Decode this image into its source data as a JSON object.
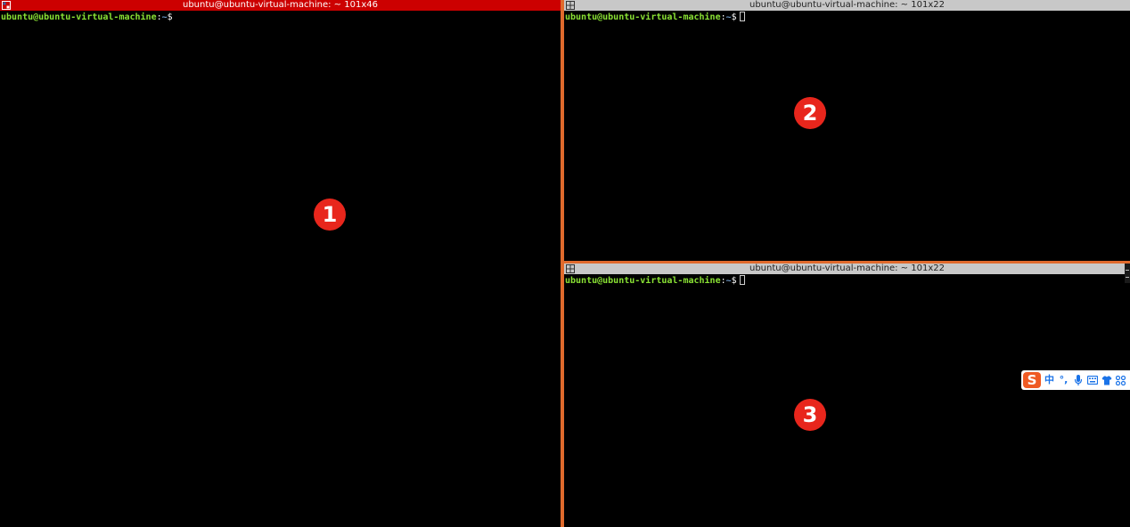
{
  "terminals": [
    {
      "title": "ubuntu@ubuntu-virtual-machine: ~ 101x46",
      "active": true,
      "prompt": {
        "user_host": "ubuntu@ubuntu-virtual-machine",
        "separator": ":",
        "path": "~",
        "symbol": "$"
      },
      "badge": "1"
    },
    {
      "title": "ubuntu@ubuntu-virtual-machine: ~ 101x22",
      "active": false,
      "prompt": {
        "user_host": "ubuntu@ubuntu-virtual-machine",
        "separator": ":",
        "path": "~",
        "symbol": "$"
      },
      "badge": "2"
    },
    {
      "title": "ubuntu@ubuntu-virtual-machine: ~ 101x22",
      "active": false,
      "prompt": {
        "user_host": "ubuntu@ubuntu-virtual-machine",
        "separator": ":",
        "path": "~",
        "symbol": "$"
      },
      "badge": "3"
    }
  ],
  "ime_toolbar": {
    "logo": "S",
    "mode_label": "中",
    "punct_label": "°,",
    "icons": [
      "sogou-logo-icon",
      "microphone-icon",
      "keyboard-icon",
      "shirt-icon",
      "grid-icon"
    ]
  },
  "colors": {
    "active_title_bg": "#cc0000",
    "inactive_title_bg": "#c8c8c8",
    "pane_divider": "#e06a2c",
    "prompt_user": "#8ae234",
    "prompt_path": "#729fcf",
    "badge_bg": "#e8261c"
  }
}
